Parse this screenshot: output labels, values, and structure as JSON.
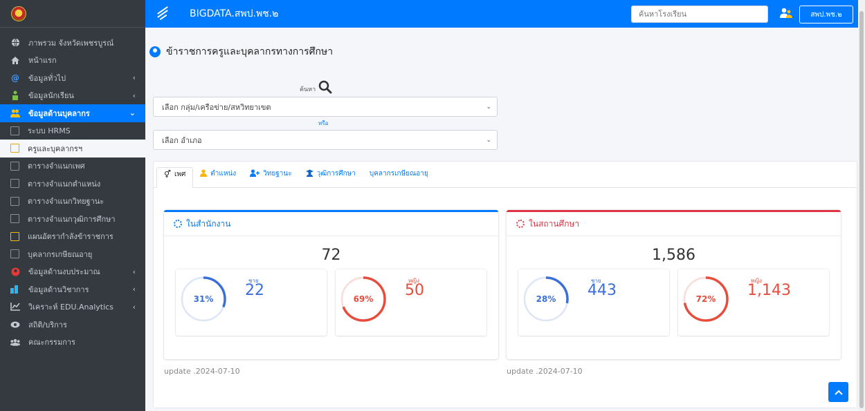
{
  "header": {
    "app_title": "BIGDATA.สพป.พช.๒",
    "search_placeholder": "ค้นหาโรงเรียน",
    "user_button": "สพป.พช.๒"
  },
  "sidebar": {
    "items": [
      {
        "label": "ภาพรวม จังหวัดเพชรบูรณ์",
        "icon": "globe-icon",
        "arrow": ""
      },
      {
        "label": "หน้าแรก",
        "icon": "home-icon",
        "arrow": ""
      },
      {
        "label": "ข้อมูลทั่วไป",
        "icon": "at-icon",
        "arrow": "‹"
      },
      {
        "label": "ข้อมูลนักเรียน",
        "icon": "student-icon",
        "arrow": "‹"
      },
      {
        "label": "ข้อมูลด้านบุคลากร",
        "icon": "users-icon",
        "arrow": "⌄"
      },
      {
        "label": "ระบบ HRMS",
        "icon": "square-icon",
        "arrow": ""
      },
      {
        "label": "ครูและบุคลากรฯ",
        "icon": "square-icon",
        "arrow": ""
      },
      {
        "label": "ตารางจำแนกเพศ",
        "icon": "square-icon",
        "arrow": ""
      },
      {
        "label": "ตารางจำแนกตำแหน่ง",
        "icon": "square-icon",
        "arrow": ""
      },
      {
        "label": "ตารางจำแนกวิทยฐานะ",
        "icon": "square-icon",
        "arrow": ""
      },
      {
        "label": "ตารางจำแนกวุฒิการศึกษา",
        "icon": "square-icon",
        "arrow": ""
      },
      {
        "label": "แผนอัตรากำลังข้าราชการ",
        "icon": "square-icon",
        "arrow": ""
      },
      {
        "label": "บุคลากรเกษียณอายุ",
        "icon": "square-icon",
        "arrow": ""
      },
      {
        "label": "ข้อมูลด้านงบประมาณ",
        "icon": "budget-icon",
        "arrow": "‹"
      },
      {
        "label": "ข้อมูลด้านวิชาการ",
        "icon": "academic-icon",
        "arrow": "‹"
      },
      {
        "label": "วิเคราะห์ EDU.Analytics",
        "icon": "chart-icon",
        "arrow": "‹"
      },
      {
        "label": "สถิติ/บริการ",
        "icon": "eye-icon",
        "arrow": ""
      },
      {
        "label": "คณะกรรมการ",
        "icon": "committee-icon",
        "arrow": ""
      }
    ]
  },
  "page": {
    "title": "ข้าราชการครูและบุคลากรทางการศึกษา",
    "search_label": "ค้นหา",
    "select_group": "เลือก กลุ่ม/เครือข่าย/สหวิทยาเขต",
    "or_label": "หรือ",
    "select_district": "เลือก อำเภอ"
  },
  "tabs": [
    {
      "label": "เพศ",
      "icon": "⚥"
    },
    {
      "label": "ตำแหน่ง",
      "icon": "👤"
    },
    {
      "label": "วิทยฐานะ",
      "icon": "👥"
    },
    {
      "label": "วุฒิการศึกษา",
      "icon": "🎓"
    },
    {
      "label": "บุคลากรเกษียณอายุ",
      "icon": ""
    }
  ],
  "office": {
    "title": "ในสำนักงาน",
    "total": "72",
    "male_label": "ชาย",
    "male_value": "22",
    "male_pct": "31%",
    "male_fraction": 0.31,
    "female_label": "หญิง",
    "female_value": "50",
    "female_pct": "69%",
    "female_fraction": 0.69,
    "update": "update .2024-07-10"
  },
  "school": {
    "title": "ในสถานศึกษา",
    "total": "1,586",
    "male_label": "ชาย",
    "male_value": "443",
    "male_pct": "28%",
    "male_fraction": 0.28,
    "female_label": "หญิง",
    "female_value": "1,143",
    "female_pct": "72%",
    "female_fraction": 0.72,
    "update": "update .2024-07-10"
  },
  "colors": {
    "primary": "#007bff",
    "male": "#3a6fd8",
    "female": "#e74c3c",
    "sidebar": "#343a40"
  }
}
